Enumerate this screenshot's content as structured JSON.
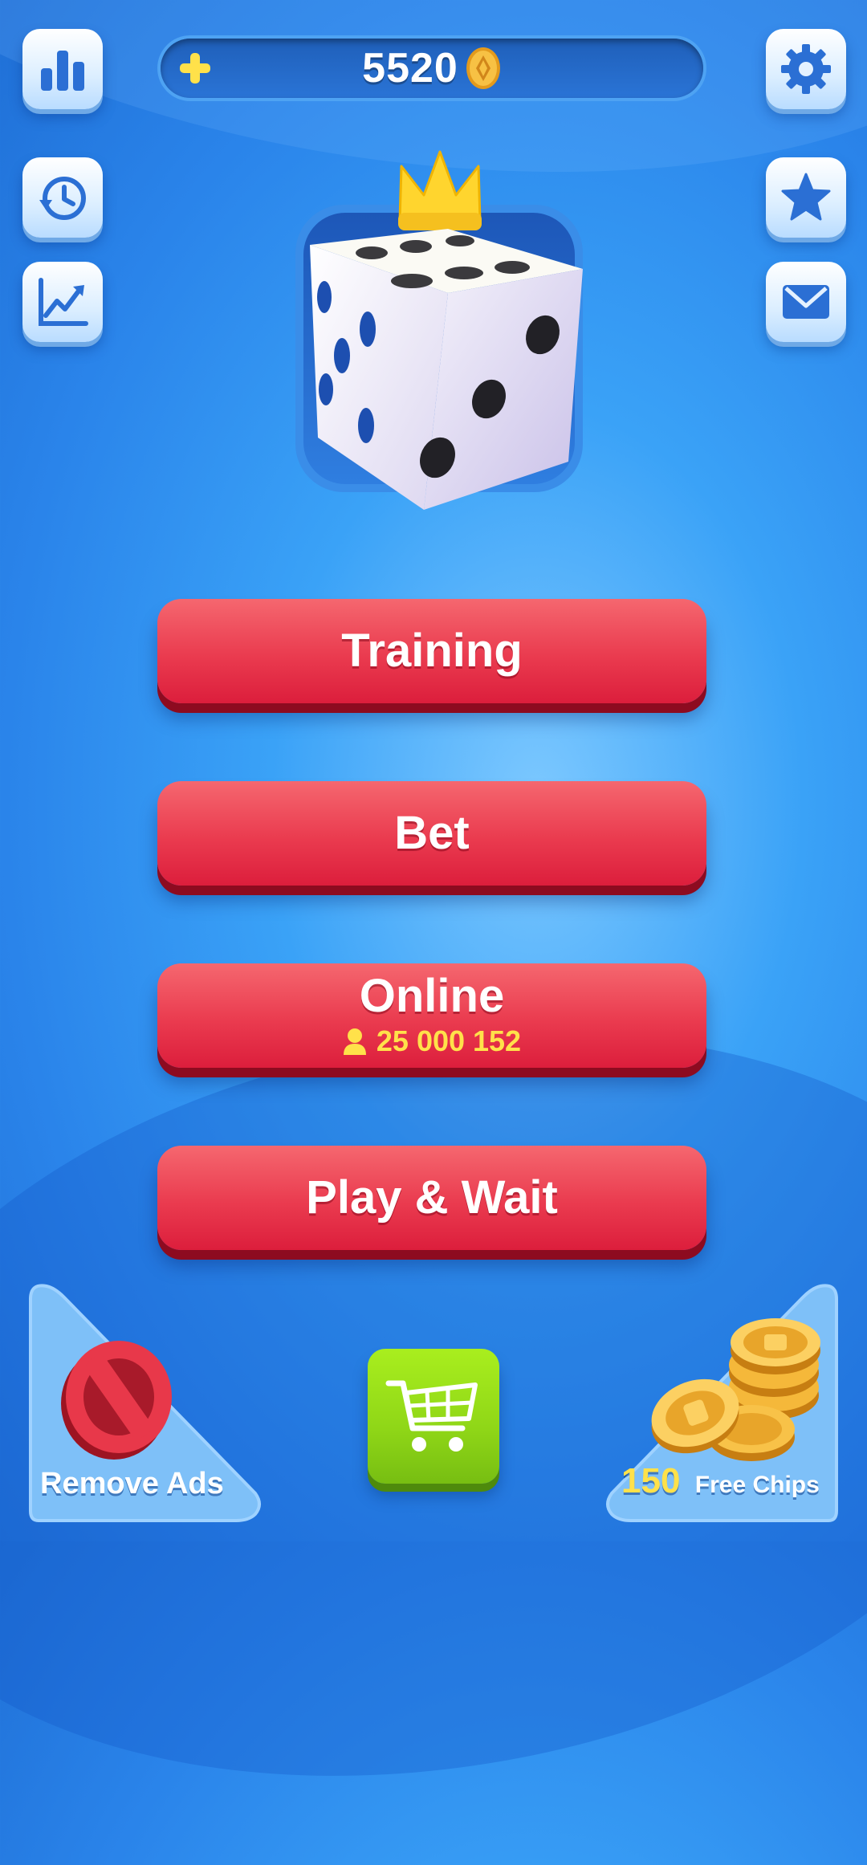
{
  "header": {
    "coins": "5520"
  },
  "menu": {
    "training_label": "Training",
    "bet_label": "Bet",
    "online_label": "Online",
    "online_players": "25 000 152",
    "play_wait_label": "Play & Wait"
  },
  "footer": {
    "remove_ads_label": "Remove Ads",
    "free_chips_amount": "150",
    "free_chips_label": "Free Chips"
  },
  "icons": {
    "stats": "bar-chart-icon",
    "history": "clock-history-icon",
    "progress": "line-chart-icon",
    "settings": "gear-icon",
    "favorites": "star-icon",
    "mail": "envelope-icon",
    "add_coins": "plus-icon",
    "coin": "coin-icon",
    "shop": "shopping-cart-icon"
  },
  "colors": {
    "background": "#3aa2f7",
    "menu_button": "#ea3b4f",
    "shop_button": "#8fd617",
    "accent_yellow": "#ffe14a"
  }
}
